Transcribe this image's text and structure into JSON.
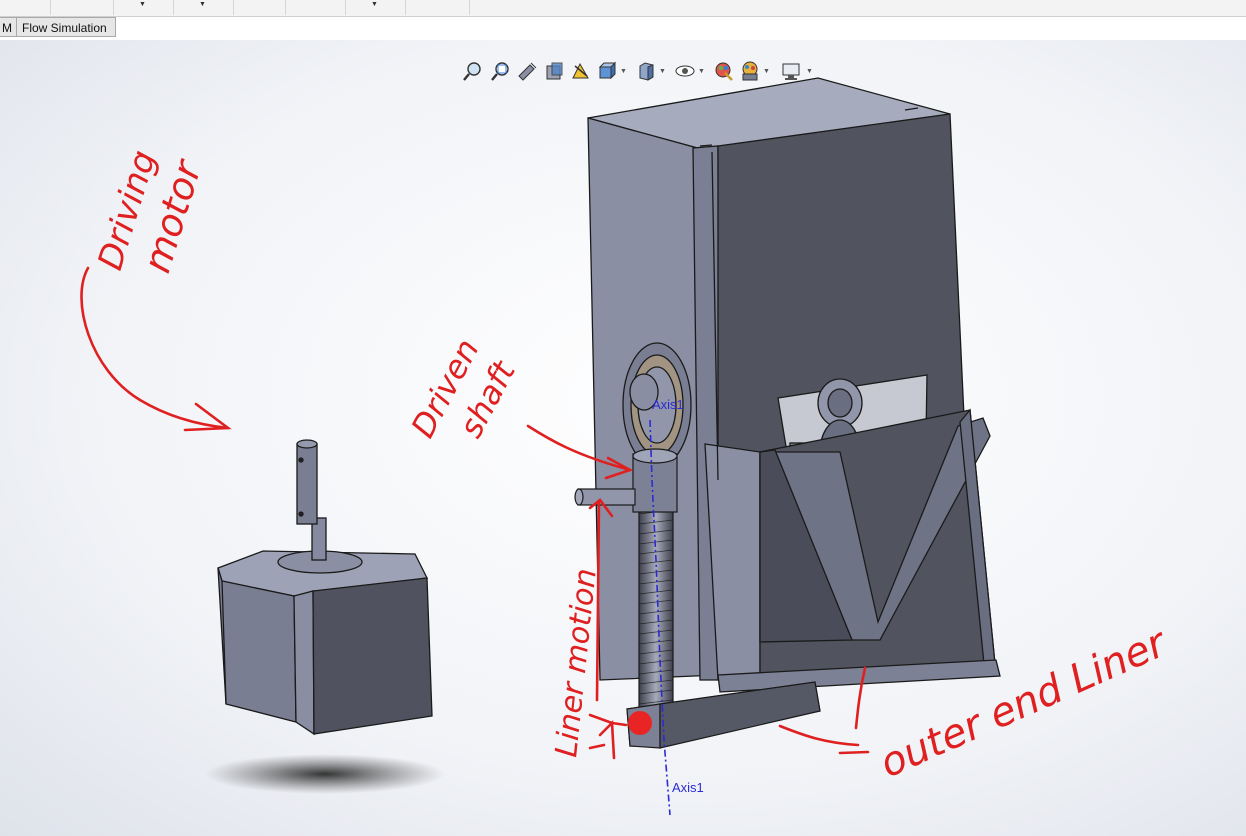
{
  "tabs": [
    {
      "label": "M",
      "active": false
    },
    {
      "label": "Flow Simulation",
      "active": false
    }
  ],
  "heads_up_toolbar": [
    {
      "icon": "zoom-to-fit-icon"
    },
    {
      "icon": "zoom-to-area-icon"
    },
    {
      "icon": "previous-view-icon"
    },
    {
      "icon": "section-view-icon"
    },
    {
      "icon": "dynamic-annotation-icon"
    },
    {
      "icon": "view-orientation-icon"
    },
    {
      "icon": "display-style-icon"
    },
    {
      "icon": "hide-show-items-icon"
    },
    {
      "icon": "edit-appearance-icon"
    },
    {
      "icon": "apply-scene-icon"
    },
    {
      "icon": "view-settings-icon"
    }
  ],
  "axes": {
    "upper": "Axis1",
    "lower": "Axis1"
  },
  "annotations": {
    "driving_motor": [
      "Driving",
      "motor"
    ],
    "driven_shaft": [
      "Driven",
      "shaft"
    ],
    "liner_motion": "Liner motion",
    "outer_end_liner": "outer end Liner"
  },
  "colors": {
    "annotation_red": "#e02020",
    "axis_blue": "#2b2bd6",
    "model_face_light": "#8e92a6",
    "model_face_mid": "#6e7285",
    "model_face_dark": "#4e5160",
    "ui_tab_bg": "#e6e6e6"
  }
}
